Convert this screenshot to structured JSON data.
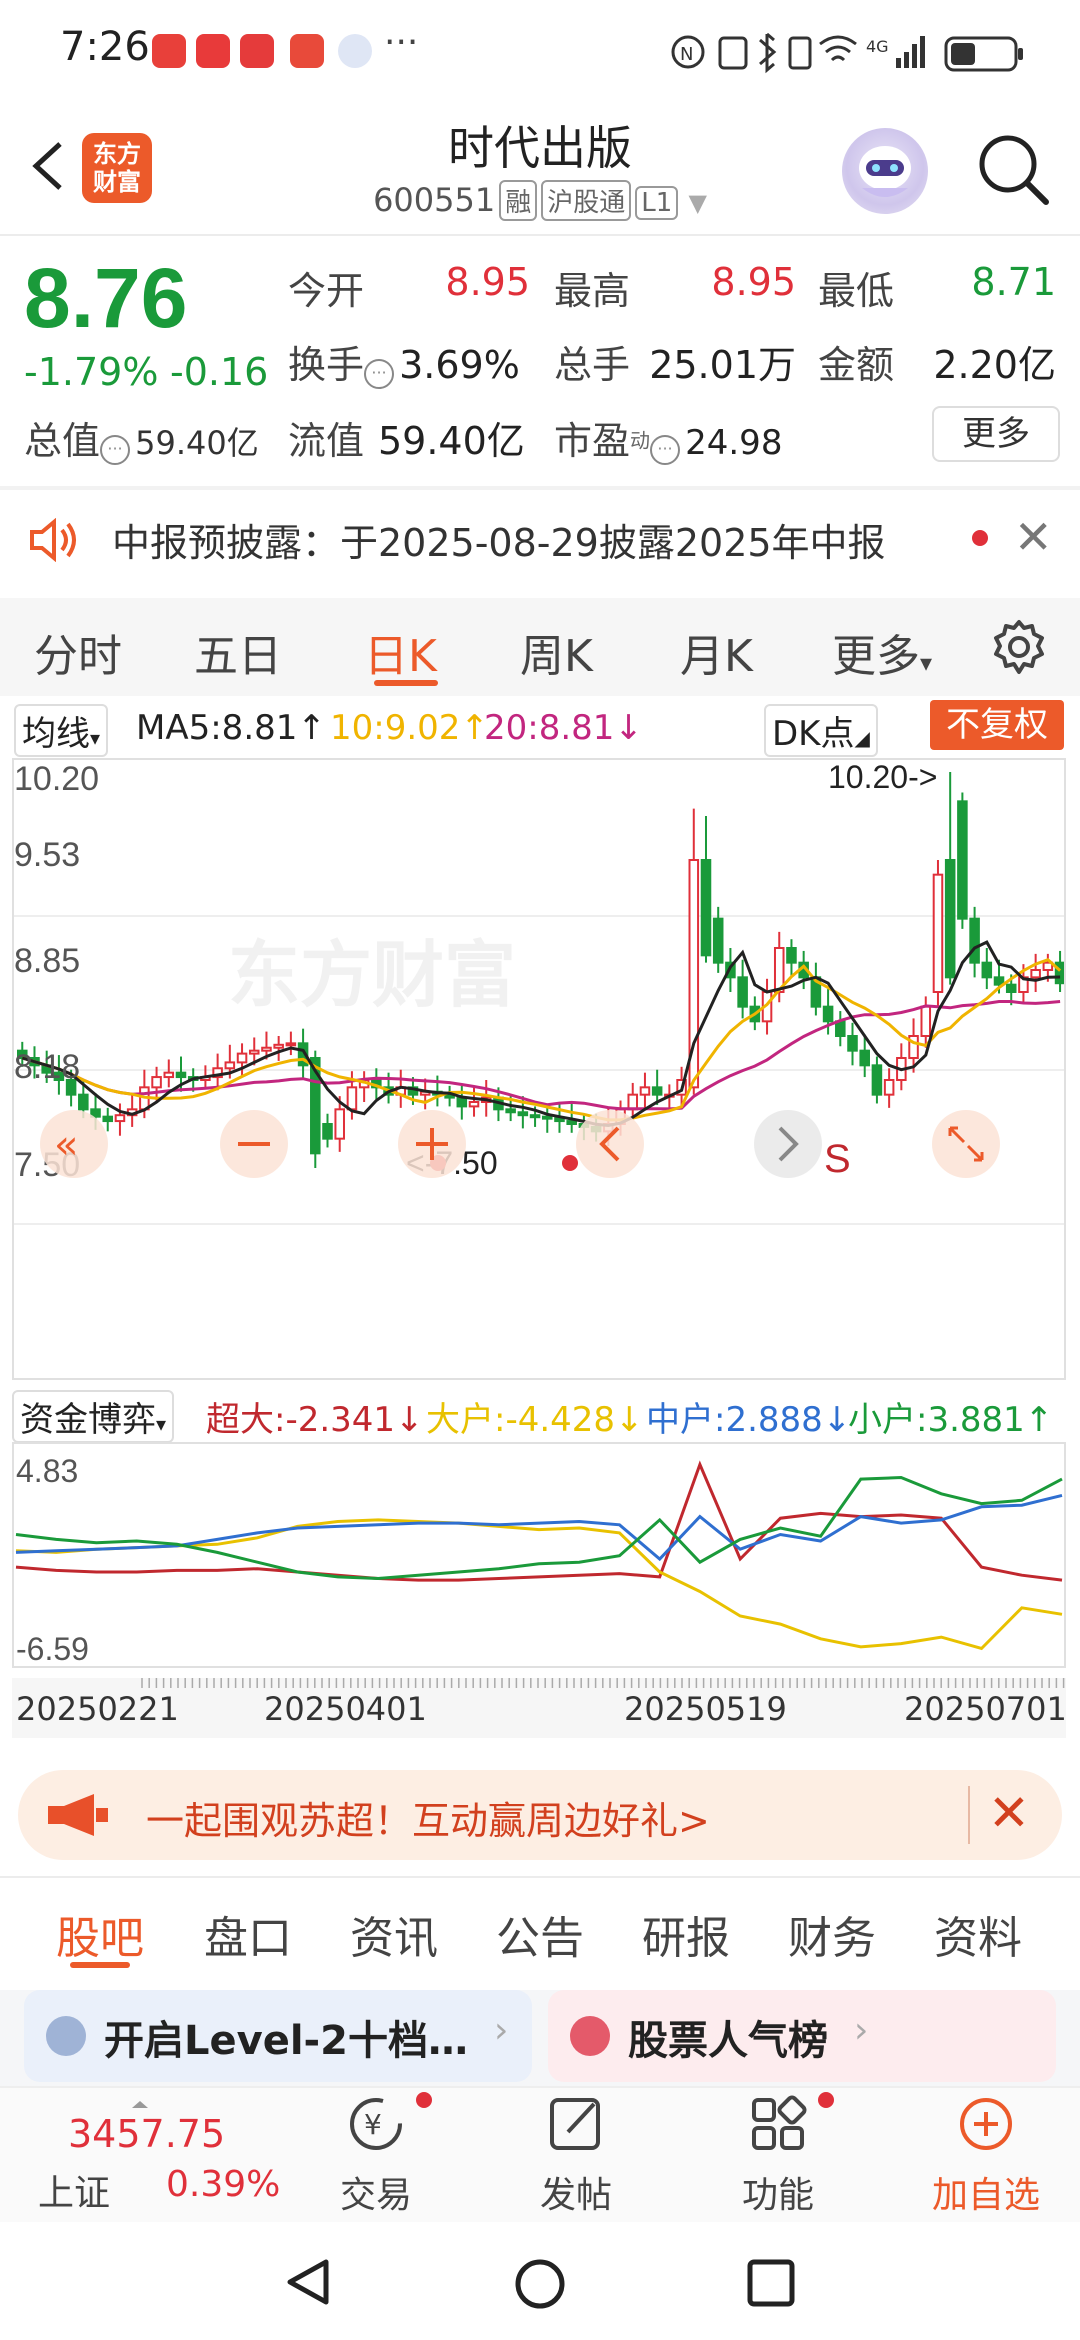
{
  "status_bar": {
    "time": "7:26",
    "overflow": "···",
    "network": "4G",
    "icons": [
      "notification-app-icons",
      "nfc-icon",
      "bluetooth-icon",
      "vibrate-icon",
      "wifi-icon",
      "signal-icon",
      "battery-icon"
    ]
  },
  "header": {
    "logo_line1": "东方",
    "logo_line2": "财富",
    "title": "时代出版",
    "code": "600551",
    "tag_rong": "融",
    "tag_hgt": "沪股通",
    "tag_l1": "L1"
  },
  "quote": {
    "price": "8.76",
    "change_pct": "-1.79%",
    "change_abs": "-0.16",
    "total_value_label": "总值",
    "total_value": "59.40亿",
    "open_label": "今开",
    "open": "8.95",
    "high_label": "最高",
    "high": "8.95",
    "low_label": "最低",
    "low": "8.71",
    "turnover_label": "换手",
    "turnover": "3.69%",
    "volume_label": "总手",
    "volume": "25.01万",
    "amount_label": "金额",
    "amount": "2.20亿",
    "float_label": "流值",
    "float_value": "59.40亿",
    "pe_label": "市盈",
    "pe_sup": "动",
    "pe": "24.98",
    "more": "更多"
  },
  "announcement": {
    "text": "中报预披露：于2025-08-29披露2025年中报"
  },
  "tabs": [
    "分时",
    "五日",
    "日K",
    "周K",
    "月K",
    "更多"
  ],
  "active_tab": 2,
  "ma_row": {
    "selector": "均线",
    "ma5": "MA5:8.81",
    "ma10": "10:9.02",
    "ma20": "20:8.81",
    "dk": "DK点",
    "fq": "不复权"
  },
  "kline": {
    "y_labels": [
      "10.20",
      "9.53",
      "8.85",
      "8.18",
      "7.50"
    ],
    "max_marker": "10.20->",
    "min_marker": "<-7.50",
    "watermark": "东方财富",
    "sell_marker": "S"
  },
  "fund_row": {
    "selector": "资金博弈",
    "super": "超大:-2.341",
    "big": "大户:-4.428",
    "mid": "中户:2.888",
    "small": "小户:3.881"
  },
  "fund_chart": {
    "y_top": "4.83",
    "y_bottom": "-6.59"
  },
  "dates": [
    "20250221",
    "20250401",
    "20250519",
    "20250701"
  ],
  "colors": {
    "accent": "#ec5a2a",
    "up": "#e0303a",
    "down": "#1a9a3a",
    "ma5": "#222222",
    "ma10": "#f0b400",
    "ma20": "#c2267f",
    "mid": "#2f6fd0",
    "small": "#1a9a3a",
    "big": "#e8c100",
    "super": "#c0282e"
  },
  "promo": {
    "text": "一起围观苏超！互动赢周边好礼>"
  },
  "bottom_tabs": [
    "股吧",
    "盘口",
    "资讯",
    "公告",
    "研报",
    "财务",
    "资料"
  ],
  "bottom_active": 0,
  "cards": [
    {
      "label": "开启Level-2十档…",
      "icon": "level2-icon"
    },
    {
      "label": "股票人气榜",
      "icon": "chart-rank-icon"
    }
  ],
  "bottom_bar": {
    "index_value": "3457.75",
    "index_name": "上证",
    "index_change": "0.39%",
    "trade": "交易",
    "post": "发帖",
    "func": "功能",
    "add": "加自选"
  }
}
